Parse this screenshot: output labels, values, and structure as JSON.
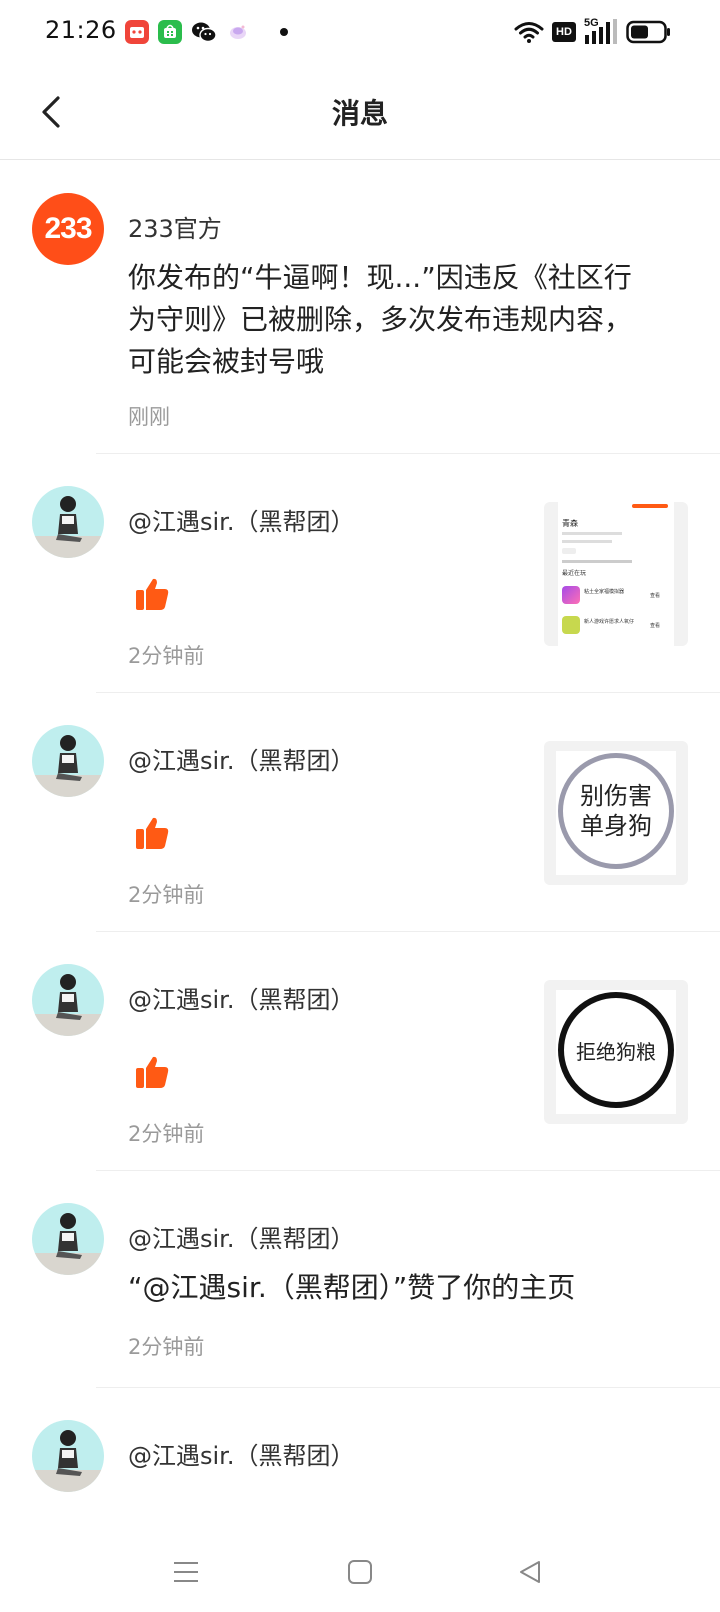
{
  "status_bar": {
    "time": "21:26",
    "network": "5G",
    "hd_label": "HD",
    "app_icons": [
      "taobao-icon",
      "app-store-icon",
      "wechat-icon",
      "assistant-icon"
    ]
  },
  "header": {
    "title": "消息",
    "back_icon": "chevron-left-icon"
  },
  "messages": [
    {
      "sender": "233官方",
      "avatar_text": "233",
      "text": "你发布的“牛逼啊！现...”因违反《社区行为守则》已被删除，多次发布违规内容，可能会被封号哦",
      "time": "刚刚"
    },
    {
      "sender": "@江遇sir.（黑帮团）",
      "type": "like",
      "time": "2分钟前",
      "thumb": {
        "profile_name": "青森",
        "section": "最近在玩",
        "games": [
          "粘土全家福模拟器",
          "新人游戏许愿求人氧仔"
        ],
        "button": "查看"
      }
    },
    {
      "sender": "@江遇sir.（黑帮团）",
      "type": "like",
      "time": "2分钟前",
      "thumb": {
        "text_top": "别伤害",
        "text_bottom": "单身狗"
      }
    },
    {
      "sender": "@江遇sir.（黑帮团）",
      "type": "like",
      "time": "2分钟前",
      "thumb": {
        "text": "拒绝狗粮"
      }
    },
    {
      "sender": "@江遇sir.（黑帮团）",
      "text": "“@江遇sir.（黑帮团）”赞了你的主页",
      "time": "2分钟前"
    },
    {
      "sender": "@江遇sir.（黑帮团）"
    }
  ],
  "colors": {
    "accent": "#ff5a14",
    "avatar_233": "#ff4e18",
    "avatar_user_bg": "#bfeeee",
    "muted_text": "#9a9a9a"
  },
  "nav": [
    "menu-icon",
    "home-square-icon",
    "back-triangle-icon"
  ]
}
